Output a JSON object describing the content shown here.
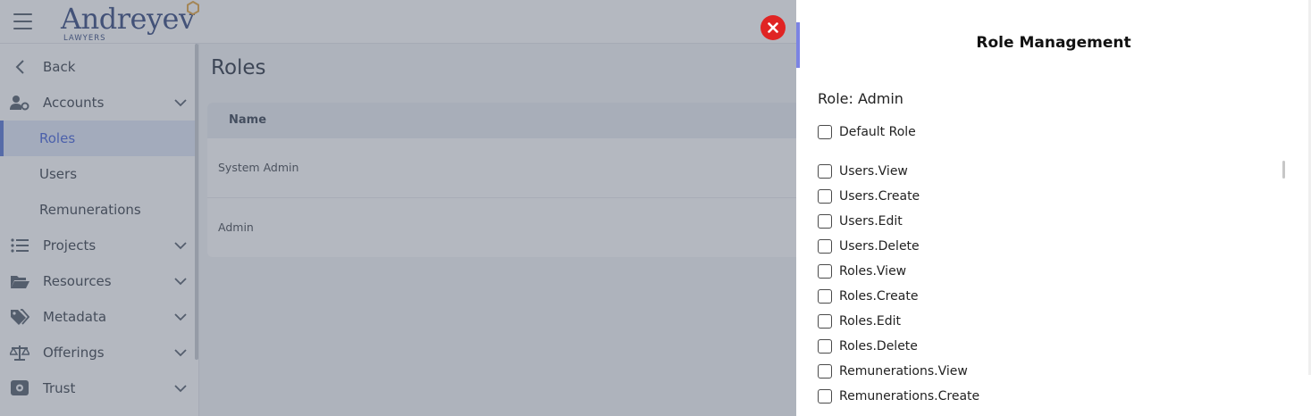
{
  "header": {
    "logo_text": "Andreyev",
    "logo_subtext": "LAWYERS",
    "logo_mark_color": "#e0a13a",
    "brand_color": "#2a3f78"
  },
  "sidebar": {
    "items": [
      {
        "label": "Back",
        "icon": "chevron-left-icon"
      },
      {
        "label": "Accounts",
        "icon": "user-gear-icon"
      },
      {
        "label": "Roles",
        "active": true
      },
      {
        "label": "Users"
      },
      {
        "label": "Remunerations"
      },
      {
        "label": "Projects",
        "icon": "list-icon"
      },
      {
        "label": "Resources",
        "icon": "folder-open-icon"
      },
      {
        "label": "Metadata",
        "icon": "tags-icon"
      },
      {
        "label": "Offerings",
        "icon": "scale-icon"
      },
      {
        "label": "Trust",
        "icon": "vault-icon"
      }
    ]
  },
  "main": {
    "title": "Roles",
    "table": {
      "headers": [
        "Name"
      ],
      "rows": [
        "System Admin",
        "Admin"
      ]
    }
  },
  "drawer": {
    "title": "Role Management",
    "role_label": "Role: Admin",
    "default_role_label": "Default Role",
    "permissions": [
      "Users.View",
      "Users.Create",
      "Users.Edit",
      "Users.Delete",
      "Roles.View",
      "Roles.Create",
      "Roles.Edit",
      "Roles.Delete",
      "Remunerations.View",
      "Remunerations.Create"
    ],
    "close_color": "#e02424",
    "accent_color": "#7b83e3"
  }
}
